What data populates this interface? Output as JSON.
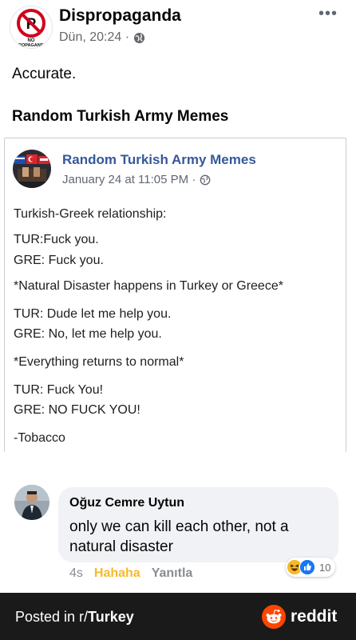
{
  "post": {
    "page_name": "Dispropaganda",
    "timestamp": "Dün, 20:24 ·",
    "privacy_icon": "globe-icon",
    "more_icon": "more-dots-icon",
    "more_label": "•••",
    "text": "Accurate.",
    "shared_page_title": "Random Turkish Army Memes",
    "avatar_logo": "NO PROPAGANDA"
  },
  "shared": {
    "page_name": "Random Turkish Army Memes",
    "timestamp": "January 24 at 11:05 PM ·",
    "lines": [
      "Turkish-Greek relationship:",
      "TUR:Fuck you.",
      "GRE: Fuck you.",
      "*Natural Disaster happens in Turkey or Greece*",
      "TUR: Dude let me help you.",
      "GRE: No, let me help you.",
      "*Everything returns to normal*",
      "TUR: Fuck You!",
      "GRE: NO FUCK YOU!",
      "-Tobacco"
    ]
  },
  "comment": {
    "author": "Oğuz Cemre Uytun",
    "text": "only we can kill each other, not a natural disaster",
    "time": "4s",
    "reaction_action": "Hahaha",
    "reply_action": "Yanıtla",
    "reaction_count": "10"
  },
  "footer": {
    "posted_prefix": "Posted in r/",
    "subreddit": "Turkey",
    "brand": "reddit"
  },
  "colors": {
    "link_blue": "#365899",
    "haha_yellow": "#f7b928",
    "like_blue": "#1877f2",
    "reddit_orange": "#ff4500",
    "footer_bg": "#1a1a1b"
  }
}
